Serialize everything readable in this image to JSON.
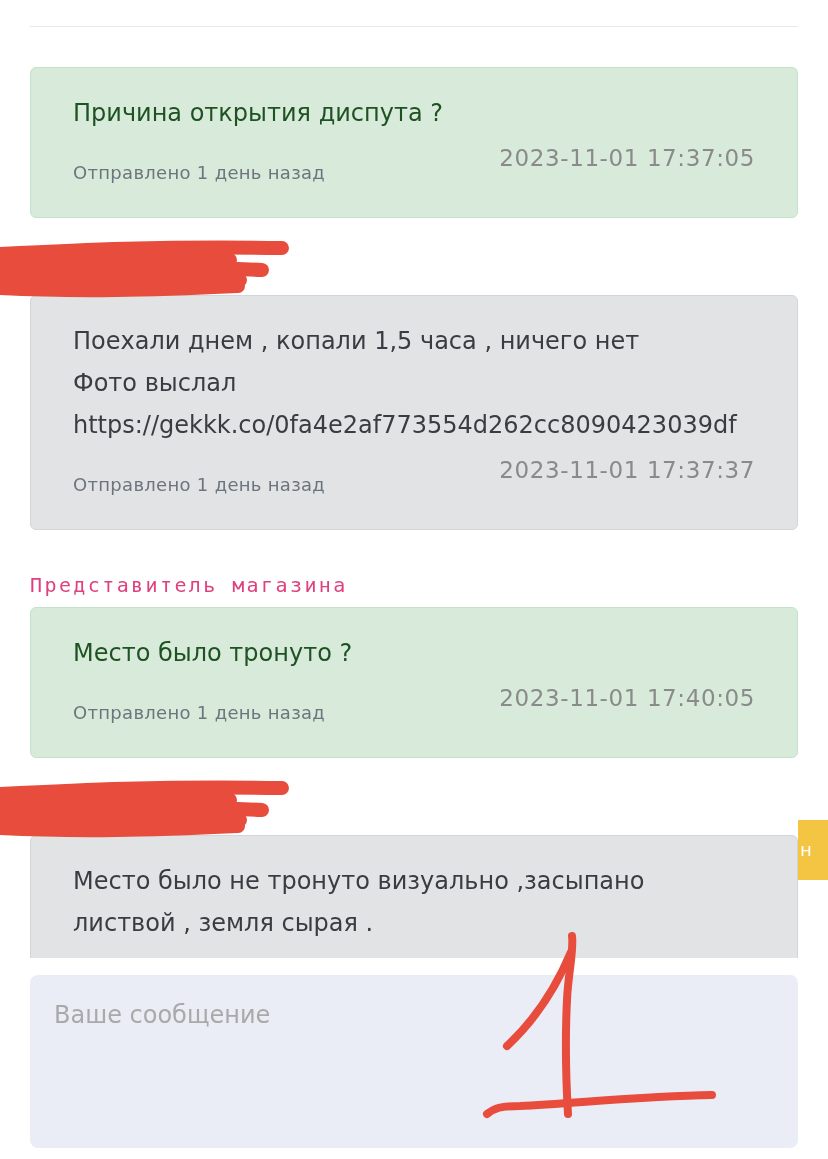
{
  "messages": [
    {
      "kind": "store",
      "redacted": false,
      "text": "Причина открытия диспута ?",
      "time": "2023-11-01 17:37:05",
      "sent": "Отправлено 1 день назад"
    },
    {
      "kind": "customer",
      "redacted": true,
      "text": "Поехали днем , копали 1,5 часа , ничего нет\nФото выслал\nhttps://gekkk.co/0fa4e2af773554d262cc8090423039df",
      "time": "2023-11-01 17:37:37",
      "sent": "Отправлено 1 день назад"
    },
    {
      "kind": "store",
      "redacted": false,
      "sender": "Представитель магазина",
      "text": "Место было тронуто ?",
      "time": "2023-11-01 17:40:05",
      "sent": "Отправлено 1 день назад"
    },
    {
      "kind": "customer",
      "redacted": true,
      "text": "Место было не тронуто визуально ,засыпано\nлиствой , земля сырая ."
    }
  ],
  "side_button": {
    "label": "н"
  },
  "composer": {
    "placeholder": "Ваше сообщение"
  }
}
